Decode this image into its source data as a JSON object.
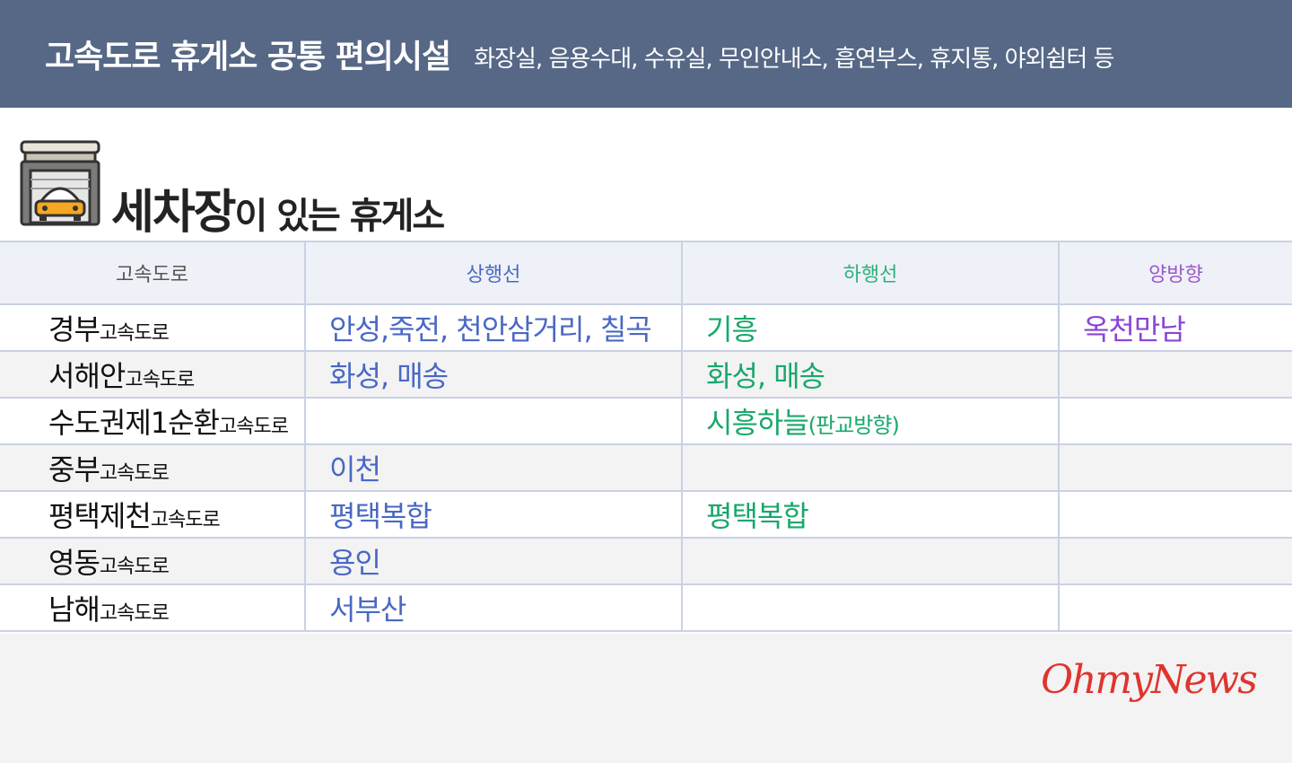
{
  "header": {
    "title": "고속도로 휴게소 공통 편의시설",
    "facilities": "화장실, 음용수대, 수유실, 무인안내소, 흡연부스, 휴지통, 야외쉼터 등"
  },
  "section": {
    "icon": "car-wash-icon",
    "title_highlight": "세차장",
    "title_rest": "이 있는 휴게소"
  },
  "table": {
    "headers": [
      "고속도로",
      "상행선",
      "하행선",
      "양방향"
    ],
    "header_colors": [
      "#555555",
      "#4a68c4",
      "#2fb07a",
      "#9b59c9"
    ],
    "highway_suffix": "고속도로",
    "rows": [
      {
        "name": "경부",
        "up": "안성,죽전, 천안삼거리, 칠곡",
        "down": "기흥",
        "down_note": "",
        "both": "옥천만남"
      },
      {
        "name": "서해안",
        "up": "화성, 매송",
        "down": "화성, 매송",
        "down_note": "",
        "both": ""
      },
      {
        "name": "수도권제1순환",
        "up": "",
        "down": "시흥하늘",
        "down_note": "(판교방향)",
        "both": ""
      },
      {
        "name": "중부",
        "up": "이천",
        "down": "",
        "down_note": "",
        "both": ""
      },
      {
        "name": "평택제천",
        "up": "평택복합",
        "down": "평택복합",
        "down_note": "",
        "both": ""
      },
      {
        "name": "영동",
        "up": "용인",
        "down": "",
        "down_note": "",
        "both": ""
      },
      {
        "name": "남해",
        "up": "서부산",
        "down": "",
        "down_note": "",
        "both": ""
      }
    ]
  },
  "logo": "OhmyNews",
  "colors": {
    "header_bg": "#566886",
    "up": "#4a68c4",
    "down": "#19a86b",
    "both": "#8a44d6",
    "logo": "#e0342e"
  }
}
